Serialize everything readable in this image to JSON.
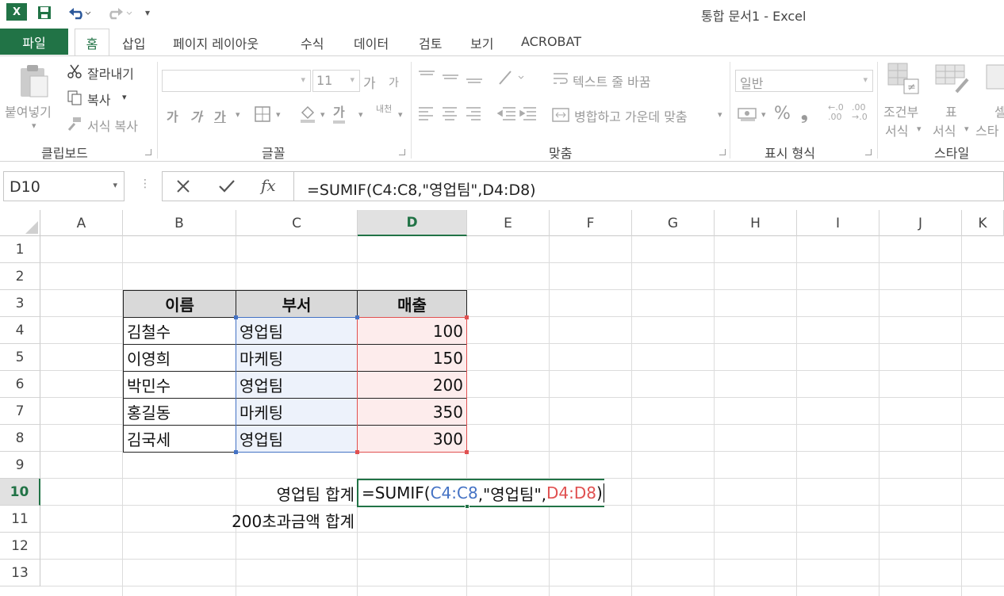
{
  "window": {
    "title": "통합 문서1 - Excel"
  },
  "tabs": {
    "file": "파일",
    "home": "홈",
    "items": [
      "삽입",
      "페이지 레이아웃",
      "수식",
      "데이터",
      "검토",
      "보기",
      "ACROBAT"
    ]
  },
  "ribbon": {
    "clipboard": {
      "paste": "붙여넣기",
      "cut": "잘라내기",
      "copy": "복사",
      "format_painter": "서식 복사",
      "group": "클립보드"
    },
    "font": {
      "size": "11",
      "bold": "가",
      "italic": "가",
      "underline": "가",
      "font_color": "가",
      "grow": "가",
      "shrink": "가",
      "phonetic": "내천",
      "group": "글꼴"
    },
    "alignment": {
      "wrap": "텍스트 줄 바꿈",
      "merge": "병합하고 가운데 맞춤",
      "group": "맞춤"
    },
    "number": {
      "format": "일반",
      "percent": "%",
      "comma": "❟",
      "inc": ".00",
      "dec": ".00",
      "inc_small": "←.0",
      "dec_small": "→.0",
      "group": "표시 형식"
    },
    "styles": {
      "conditional": "조건부",
      "conditional2": "서식",
      "table": "표",
      "table2": "서식",
      "cell": "셀",
      "cell2": "스타",
      "group": "스타일"
    }
  },
  "formula_bar": {
    "name_box": "D10",
    "formula": "=SUMIF(C4:C8,\"영업팀\",D4:D8)"
  },
  "columns": [
    "A",
    "B",
    "C",
    "D",
    "E",
    "F",
    "G",
    "H",
    "I",
    "J",
    "K"
  ],
  "rows": [
    "1",
    "2",
    "3",
    "4",
    "5",
    "6",
    "7",
    "8",
    "9",
    "10",
    "11",
    "12",
    "13"
  ],
  "table": {
    "headers": [
      "이름",
      "부서",
      "매출"
    ],
    "rows": [
      [
        "김철수",
        "영업팀",
        "100"
      ],
      [
        "이영희",
        "마케팅",
        "150"
      ],
      [
        "박민수",
        "영업팀",
        "200"
      ],
      [
        "홍길동",
        "마케팅",
        "350"
      ],
      [
        "김국세",
        "영업팀",
        "300"
      ]
    ]
  },
  "labels": {
    "sales_total": "영업팀 합계",
    "over200_total": "200초과금액 합계"
  },
  "edit": {
    "prefix": "=SUMIF(",
    "ref1": "C4:C8",
    "mid": ",\"영업팀\",",
    "ref2": "D4:D8",
    "suffix": ")"
  },
  "colors": {
    "accent": "#217346",
    "ref1": "#4472c4",
    "ref2": "#e05050"
  }
}
